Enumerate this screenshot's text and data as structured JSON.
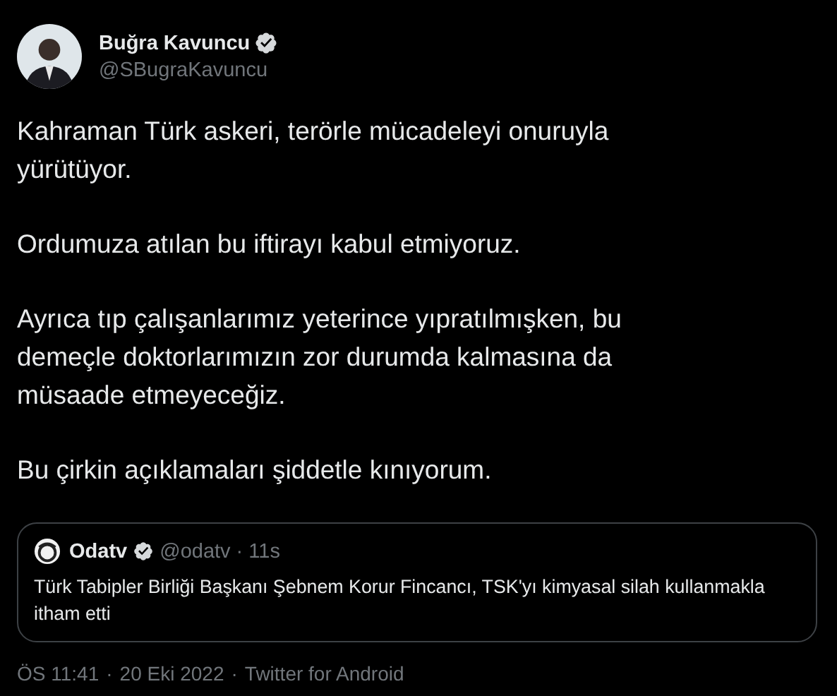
{
  "author": {
    "name": "Buğra Kavuncu",
    "handle": "@SBugraKavuncu",
    "verified": true
  },
  "paragraphs": [
    "Kahraman Türk askeri, terörle mücadeleyi onuruyla yürütüyor.",
    "Ordumuza atılan bu iftirayı kabul etmiyoruz.",
    "Ayrıca tıp çalışanlarımız yeterince yıpratılmışken, bu demeçle doktorlarımızın zor durumda kalmasına da müsaade etmeyeceğiz.",
    "Bu çirkin açıklamaları şiddetle kınıyorum."
  ],
  "quote": {
    "name": "Odatv",
    "verified": true,
    "handle": "@odatv",
    "separator": "·",
    "time": "11s",
    "text": "Türk Tabipler Birliği Başkanı Şebnem Korur Fincancı, TSK'yı kimyasal silah kullanmakla itham etti"
  },
  "footer": {
    "time": "ÖS 11:41",
    "separator_1": "·",
    "date": "20 Eki 2022",
    "separator_2": "·",
    "source": "Twitter for Android"
  }
}
